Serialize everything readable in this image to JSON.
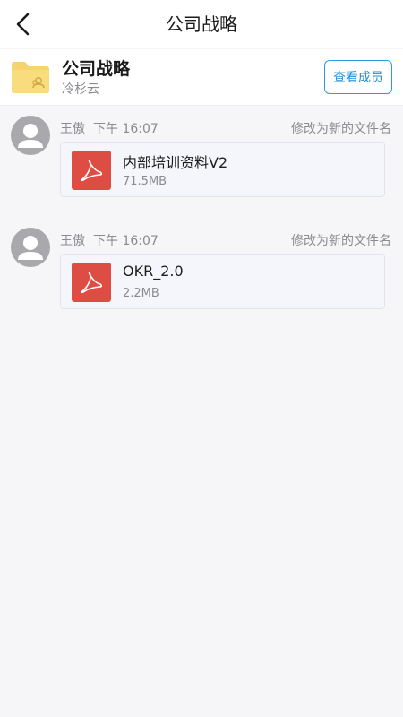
{
  "nav": {
    "title": "公司战略"
  },
  "group": {
    "name": "公司战略",
    "owner": "冷杉云",
    "members_button": "查看成员"
  },
  "entries": [
    {
      "user": "王傲",
      "time": "下午 16:07",
      "action": "修改为新的文件名",
      "file": {
        "name": "内部培训资料V2",
        "size": "71.5MB",
        "icon": "pdf-icon"
      }
    },
    {
      "user": "王傲",
      "time": "下午 16:07",
      "action": "修改为新的文件名",
      "file": {
        "name": "OKR_2.0",
        "size": "2.2MB",
        "icon": "pdf-icon"
      }
    }
  ],
  "colors": {
    "accent": "#2d9be0",
    "pdf": "#de4d44",
    "folder": "#f7d36f",
    "avatar": "#a9a9ad"
  }
}
